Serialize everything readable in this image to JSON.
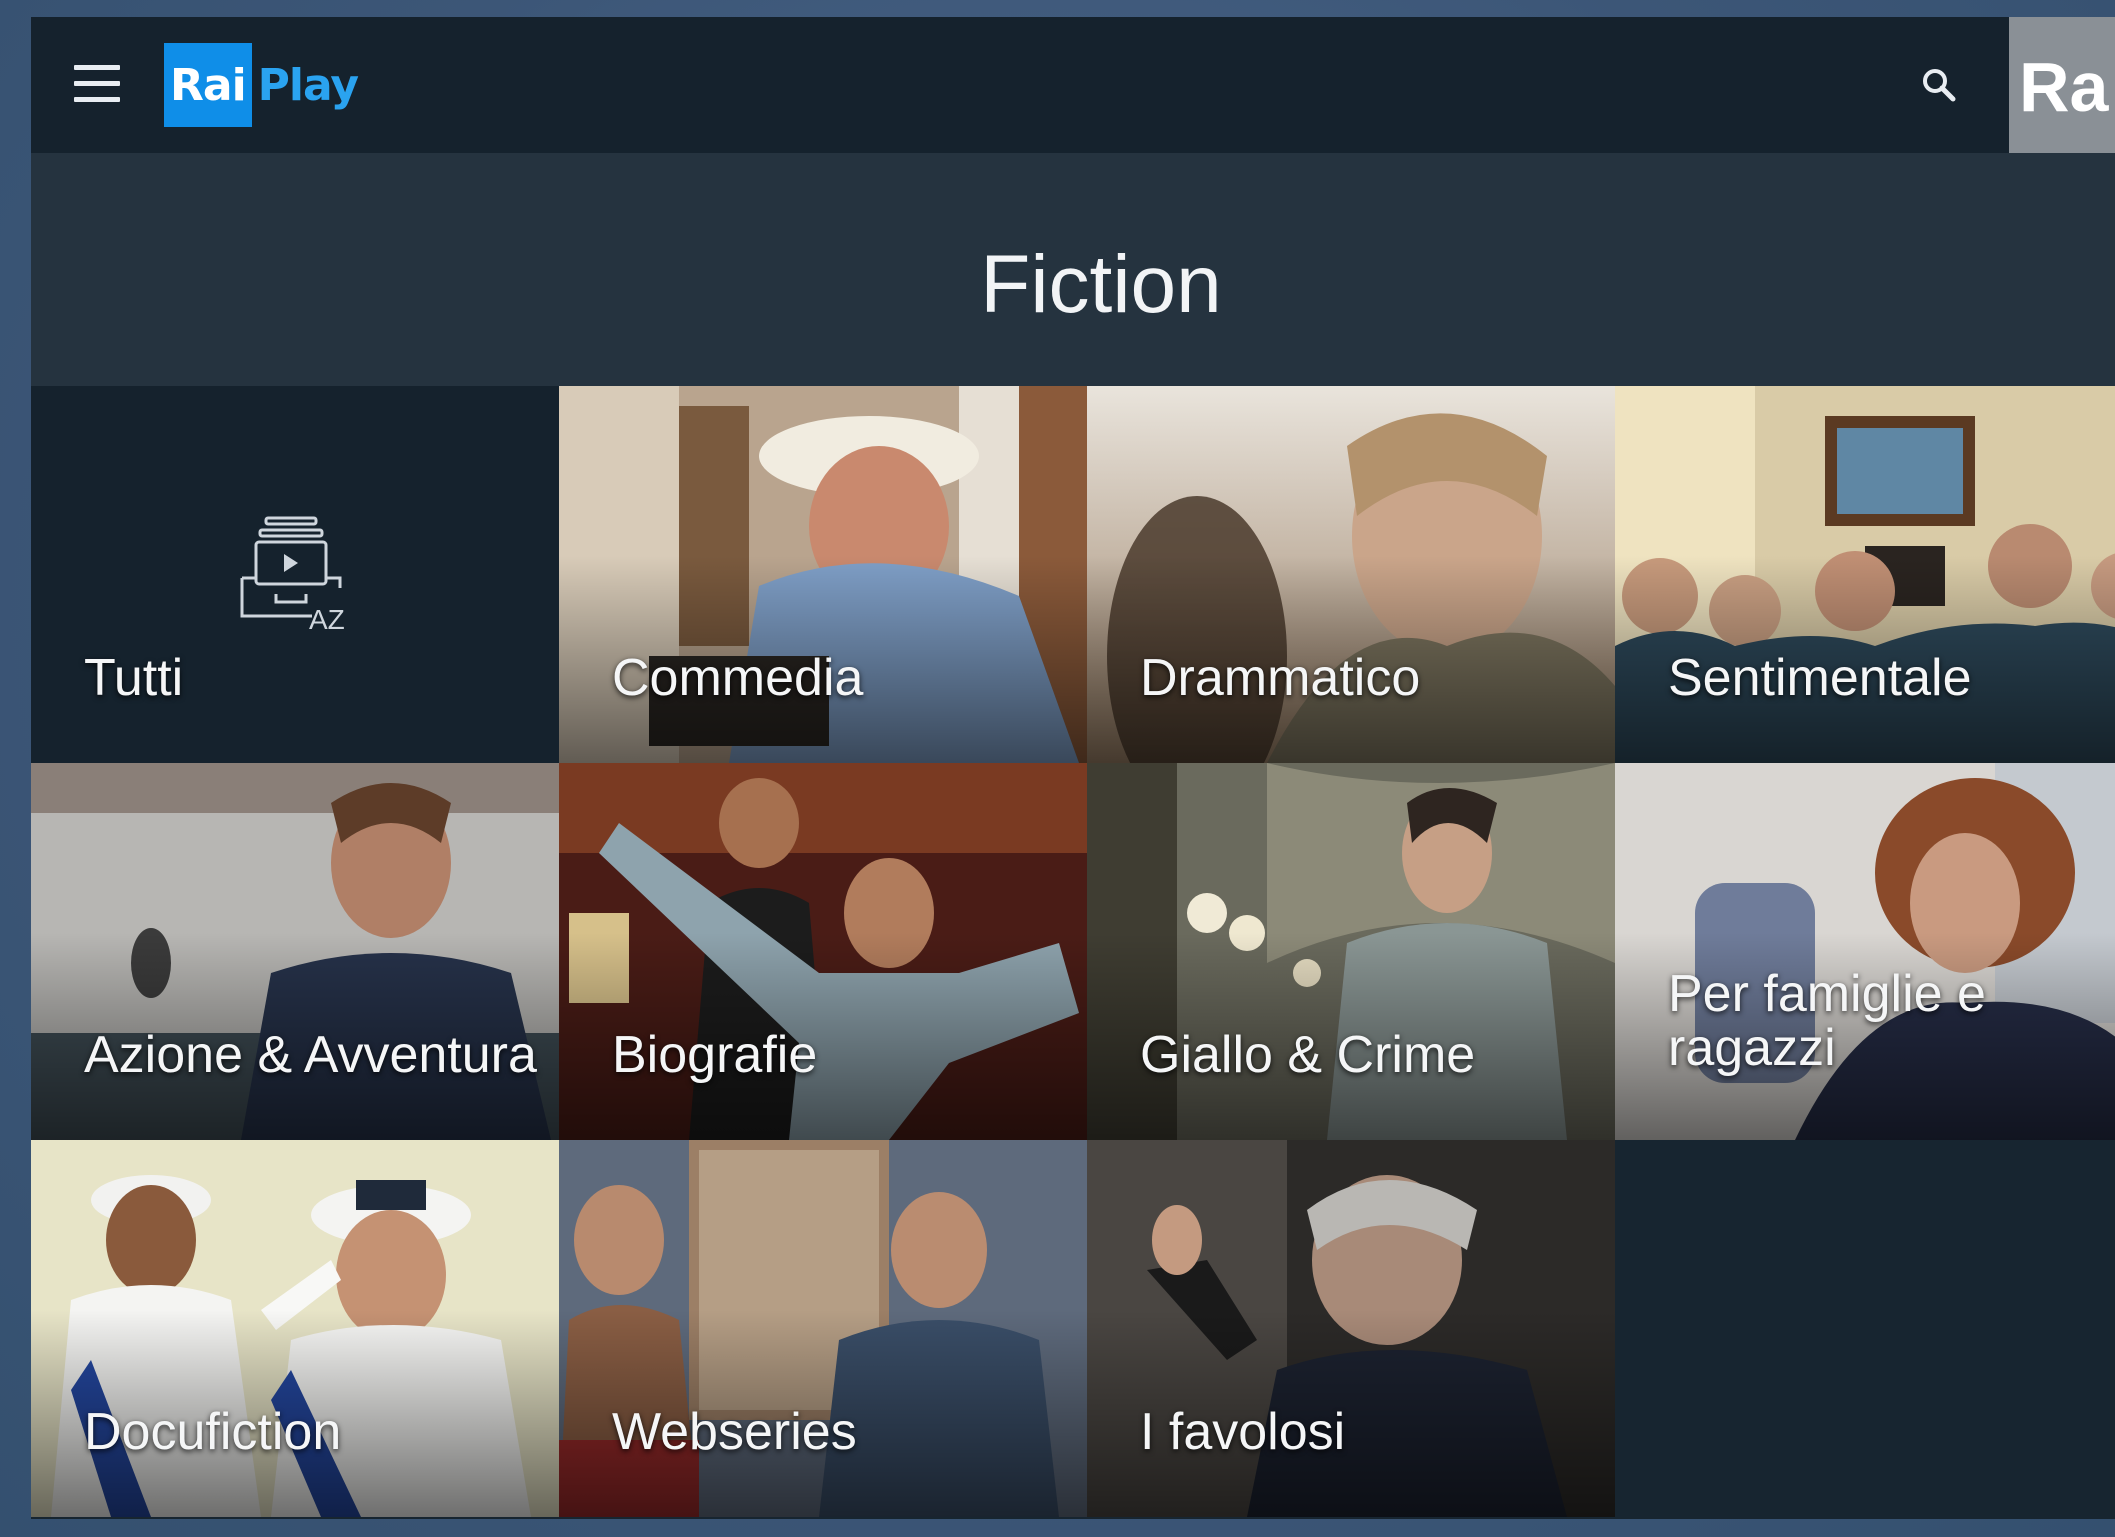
{
  "app": {
    "logo_rai": "Rai",
    "logo_play": "Play",
    "brand_chip": "Ra"
  },
  "icons": {
    "menu": "hamburger-menu-icon",
    "search": "search-icon",
    "catalog": "az-catalog-icon",
    "catalog_badge": "AZ"
  },
  "page": {
    "title": "Fiction"
  },
  "tiles": [
    {
      "label": "Tutti"
    },
    {
      "label": "Commedia"
    },
    {
      "label": "Drammatico"
    },
    {
      "label": "Sentimentale"
    },
    {
      "label": "Azione & Avventura"
    },
    {
      "label": "Biografie"
    },
    {
      "label": "Giallo & Crime"
    },
    {
      "label": "Per famiglie e ragazzi"
    },
    {
      "label": "Docufiction"
    },
    {
      "label": "Webseries"
    },
    {
      "label": "I favolosi"
    }
  ],
  "colors": {
    "accent": "#0f8ee8",
    "topbar": "#15222d",
    "header": "#25333f"
  }
}
